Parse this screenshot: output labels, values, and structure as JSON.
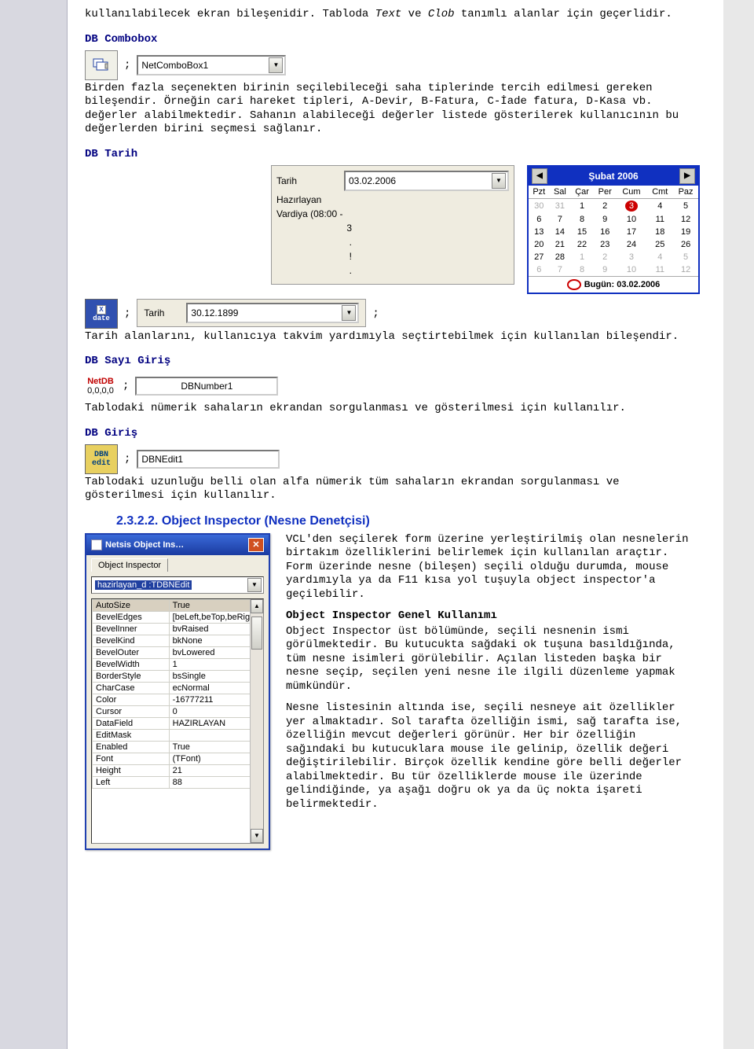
{
  "intro": {
    "p1_a": "kullanılabilecek ekran bileşenidir. Tabloda ",
    "p1_text": "Text",
    "p1_mid": " ve ",
    "p1_clob": "Clob",
    "p1_b": " tanımlı alanlar için geçerlidir."
  },
  "sections": {
    "combobox_title": "DB Combobox",
    "combobox_label": "NetComboBox1",
    "combobox_para": "Birden fazla seçenekten birinin seçilebileceği saha tiplerinde tercih edilmesi gereken bileşendir. Örneğin cari hareket tipleri, A-Devir, B-Fatura, C-İade fatura, D-Kasa vb. değerler alabilmektedir. Sahanın alabileceği değerler listede gösterilerek kullanıcının bu değerlerden birini seçmesi sağlanır.",
    "tarih_title": "DB Tarih",
    "tarih_para": "Tarih alanlarını, kullanıcıya takvim yardımıyla seçtirtebilmek için kullanılan bileşendir.",
    "sayi_title": "DB Sayı Giriş",
    "sayi_icon_top": "NetDB",
    "sayi_icon_bot": "0,0,0,0",
    "sayi_input": "DBNumber1",
    "sayi_para": "Tablodaki nümerik sahaların ekrandan sorgulanması ve gösterilmesi için kullanılır.",
    "giris_title": "DB Giriş",
    "giris_icon_top": "DBN",
    "giris_icon_bot": "edit",
    "giris_input": "DBNEdit1",
    "giris_para": "Tablodaki uzunluğu belli olan alfa nümerik tüm sahaların ekrandan sorgulanması ve gösterilmesi için kullanılır."
  },
  "datepanel": {
    "label_tarih": "Tarih",
    "label_hazirlayan": "Hazırlayan",
    "label_vardiya": "Vardiya (08:00 -",
    "value_date_top": "03.02.2006",
    "value_date_bottom": "30.12.1899"
  },
  "calendar": {
    "month": "Şubat 2006",
    "dow": [
      "Pzt",
      "Sal",
      "Çar",
      "Per",
      "Cum",
      "Cmt",
      "Paz"
    ],
    "rows": [
      [
        {
          "v": "30",
          "o": true
        },
        {
          "v": "31",
          "o": true
        },
        {
          "v": "1"
        },
        {
          "v": "2"
        },
        {
          "v": "3",
          "sel": true
        },
        {
          "v": "4"
        },
        {
          "v": "5"
        }
      ],
      [
        {
          "v": "6"
        },
        {
          "v": "7"
        },
        {
          "v": "8"
        },
        {
          "v": "9"
        },
        {
          "v": "10"
        },
        {
          "v": "11"
        },
        {
          "v": "12"
        }
      ],
      [
        {
          "v": "13"
        },
        {
          "v": "14"
        },
        {
          "v": "15"
        },
        {
          "v": "16"
        },
        {
          "v": "17"
        },
        {
          "v": "18"
        },
        {
          "v": "19"
        }
      ],
      [
        {
          "v": "20"
        },
        {
          "v": "21"
        },
        {
          "v": "22"
        },
        {
          "v": "23"
        },
        {
          "v": "24"
        },
        {
          "v": "25"
        },
        {
          "v": "26"
        }
      ],
      [
        {
          "v": "27"
        },
        {
          "v": "28"
        },
        {
          "v": "1",
          "o": true
        },
        {
          "v": "2",
          "o": true
        },
        {
          "v": "3",
          "o": true
        },
        {
          "v": "4",
          "o": true
        },
        {
          "v": "5",
          "o": true
        }
      ],
      [
        {
          "v": "6",
          "o": true
        },
        {
          "v": "7",
          "o": true
        },
        {
          "v": "8",
          "o": true
        },
        {
          "v": "9",
          "o": true
        },
        {
          "v": "10",
          "o": true
        },
        {
          "v": "11",
          "o": true
        },
        {
          "v": "12",
          "o": true
        }
      ]
    ],
    "today_label": "Bugün: 03.02.2006"
  },
  "heading": {
    "num": "2.3.2.2. ",
    "text": "Object Inspector (Nesne Denetçisi)"
  },
  "oi": {
    "title": "Netsis Object Ins…",
    "tab": "Object Inspector",
    "selected": "hazirlayan_d :TDBNEdit",
    "rows": [
      {
        "n": "AutoSize",
        "v": "True",
        "hl": true
      },
      {
        "n": "BevelEdges",
        "v": "[beLeft,beTop,beRig"
      },
      {
        "n": "BevelInner",
        "v": "bvRaised"
      },
      {
        "n": "BevelKind",
        "v": "bkNone"
      },
      {
        "n": "BevelOuter",
        "v": "bvLowered"
      },
      {
        "n": "BevelWidth",
        "v": "1"
      },
      {
        "n": "BorderStyle",
        "v": "bsSingle"
      },
      {
        "n": "CharCase",
        "v": "ecNormal"
      },
      {
        "n": "Color",
        "v": "-16777211"
      },
      {
        "n": "Cursor",
        "v": "0"
      },
      {
        "n": "DataField",
        "v": "HAZIRLAYAN"
      },
      {
        "n": "EditMask",
        "v": ""
      },
      {
        "n": "Enabled",
        "v": "True"
      },
      {
        "n": "Font",
        "v": "(TFont)"
      },
      {
        "n": "Height",
        "v": "21"
      },
      {
        "n": "Left",
        "v": "88"
      }
    ]
  },
  "oi_text": {
    "p1": "VCL'den seçilerek form üzerine yerleştirilmiş olan nesnelerin birtakım özelliklerini belirlemek için kullanılan araçtır. Form üzerinde nesne (bileşen) seçili olduğu durumda, mouse yardımıyla ya da F11 kısa yol tuşuyla object inspector'a geçilebilir.",
    "sub": "Object Inspector Genel Kullanımı",
    "p2": "Object Inspector üst bölümünde, seçili nesnenin ismi görülmektedir. Bu kutucukta sağdaki ok tuşuna basıldığında, tüm nesne isimleri görülebilir. Açılan listeden başka bir nesne seçip, seçilen yeni nesne ile ilgili düzenleme yapmak mümkündür.",
    "p3": "Nesne listesinin altında ise, seçili nesneye ait özellikler yer almaktadır. Sol tarafta özelliğin ismi, sağ tarafta ise, özelliğin mevcut değerleri görünür. Her bir özelliğin sağındaki bu kutucuklara mouse ile gelinip, özellik değeri değiştirilebilir. Birçok özellik kendine göre belli değerler alabilmektedir. Bu tür özelliklerde mouse ile üzerinde gelindiğinde, ya aşağı doğru ok ya da üç nokta işareti belirmektedir."
  },
  "ellipsis_3": "3",
  "semi": ";"
}
